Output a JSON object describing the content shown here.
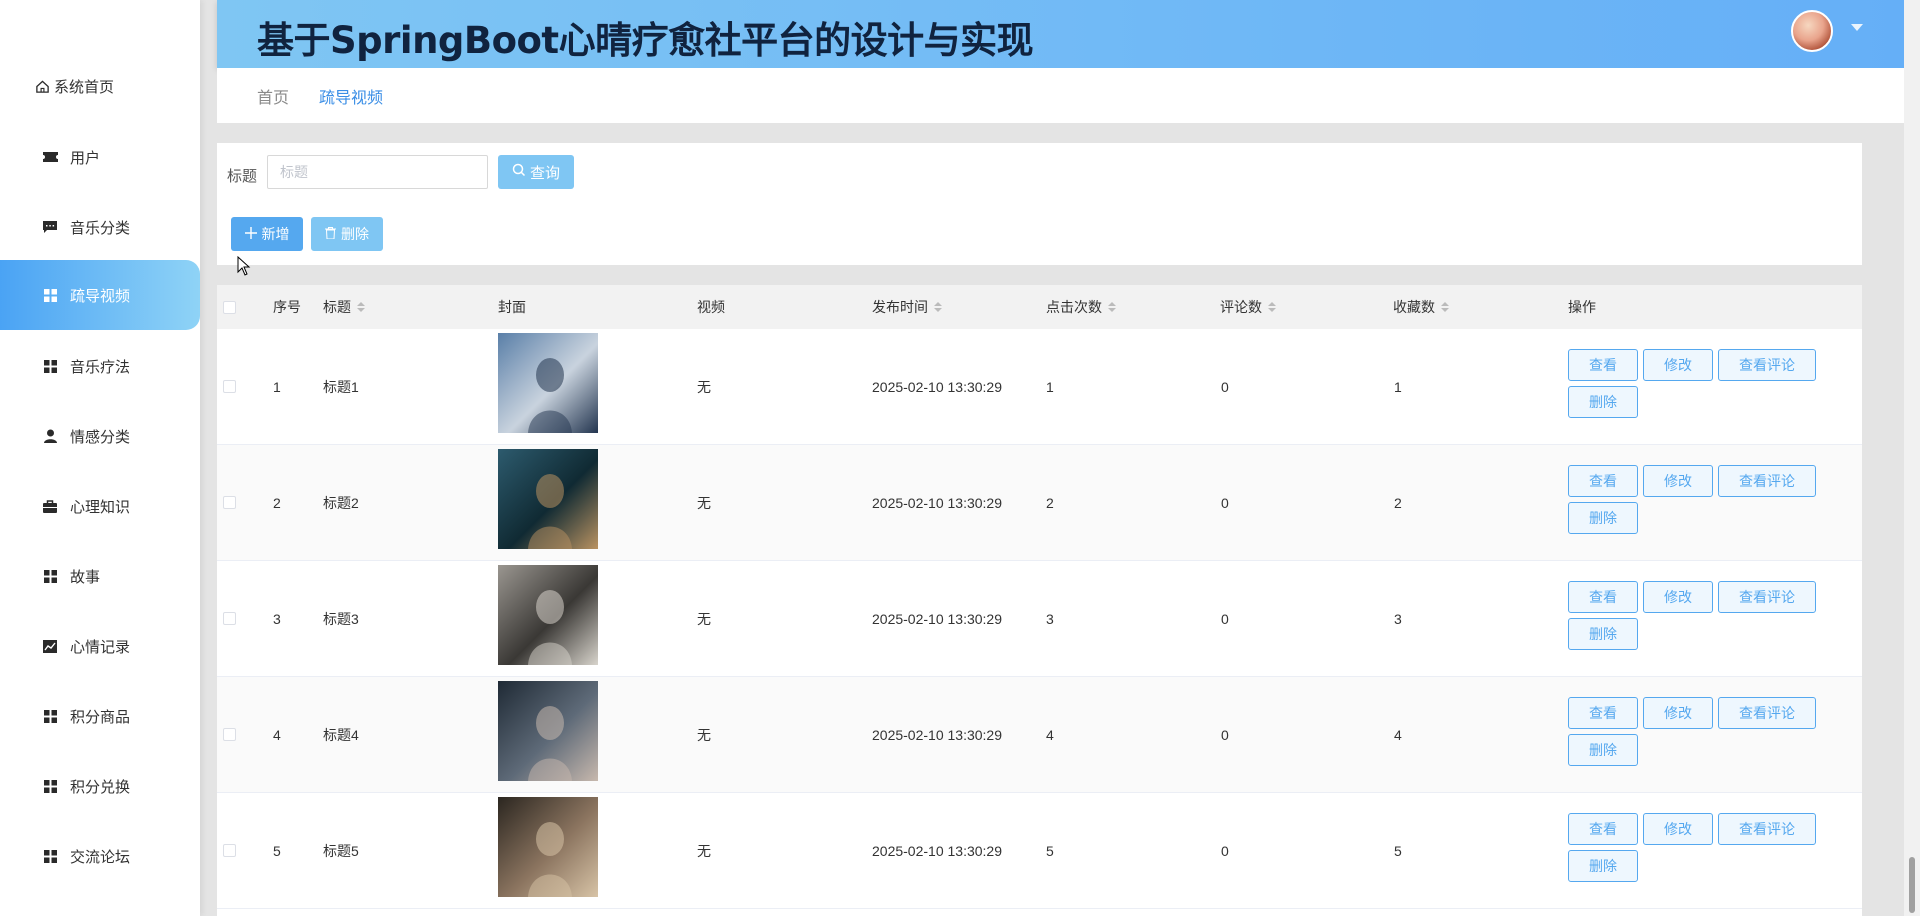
{
  "header": {
    "title": "基于SpringBoot心晴疗愈社平台的设计与实现"
  },
  "sidebar": {
    "items": [
      {
        "label": "系统首页",
        "icon": "home-icon"
      },
      {
        "label": "用户",
        "icon": "ticket-icon"
      },
      {
        "label": "音乐分类",
        "icon": "message-icon"
      },
      {
        "label": "疏导视频",
        "icon": "grid-icon",
        "active": true
      },
      {
        "label": "音乐疗法",
        "icon": "grid-icon"
      },
      {
        "label": "情感分类",
        "icon": "user-icon"
      },
      {
        "label": "心理知识",
        "icon": "briefcase-icon"
      },
      {
        "label": "故事",
        "icon": "grid-icon"
      },
      {
        "label": "心情记录",
        "icon": "chart-icon"
      },
      {
        "label": "积分商品",
        "icon": "grid-icon"
      },
      {
        "label": "积分兑换",
        "icon": "grid-icon"
      },
      {
        "label": "交流论坛",
        "icon": "grid-icon"
      }
    ]
  },
  "breadcrumb": {
    "home": "首页",
    "current": "疏导视频"
  },
  "search": {
    "label": "标题",
    "placeholder": "标题",
    "query_button": "查询"
  },
  "toolbar": {
    "add_label": "新增",
    "delete_label": "删除"
  },
  "table": {
    "headers": {
      "index": "序号",
      "title": "标题",
      "cover": "封面",
      "video": "视频",
      "publish_time": "发布时间",
      "clicks": "点击次数",
      "comments": "评论数",
      "favorites": "收藏数",
      "actions": "操作"
    },
    "action_labels": {
      "view": "查看",
      "edit": "修改",
      "view_comments": "查看评论",
      "delete": "删除"
    },
    "rows": [
      {
        "index": "1",
        "title": "标题1",
        "video": "无",
        "publish_time": "2025-02-10 13:30:29",
        "clicks": "1",
        "comments": "0",
        "favorites": "1",
        "cover_colors": [
          "#5a7fa8",
          "#c9d3de",
          "#23354f"
        ]
      },
      {
        "index": "2",
        "title": "标题2",
        "video": "无",
        "publish_time": "2025-02-10 13:30:29",
        "clicks": "2",
        "comments": "0",
        "favorites": "2",
        "cover_colors": [
          "#2d5b6e",
          "#102a33",
          "#b99261"
        ]
      },
      {
        "index": "3",
        "title": "标题3",
        "video": "无",
        "publish_time": "2025-02-10 13:30:29",
        "clicks": "3",
        "comments": "0",
        "favorites": "3",
        "cover_colors": [
          "#9a9690",
          "#3a3835",
          "#d8d4cc"
        ]
      },
      {
        "index": "4",
        "title": "标题4",
        "video": "无",
        "publish_time": "2025-02-10 13:30:29",
        "clicks": "4",
        "comments": "0",
        "favorites": "4",
        "cover_colors": [
          "#1f2a35",
          "#5e6a78",
          "#c7b8ad"
        ]
      },
      {
        "index": "5",
        "title": "标题5",
        "video": "无",
        "publish_time": "2025-02-10 13:30:29",
        "clicks": "5",
        "comments": "0",
        "favorites": "5",
        "cover_colors": [
          "#2b2620",
          "#8c7560",
          "#d7c3a6"
        ]
      }
    ]
  },
  "colors": {
    "accent": "#55a8ef",
    "header_gradient_start": "#7fc6f3",
    "sidebar_active": "#4aa3f4"
  }
}
